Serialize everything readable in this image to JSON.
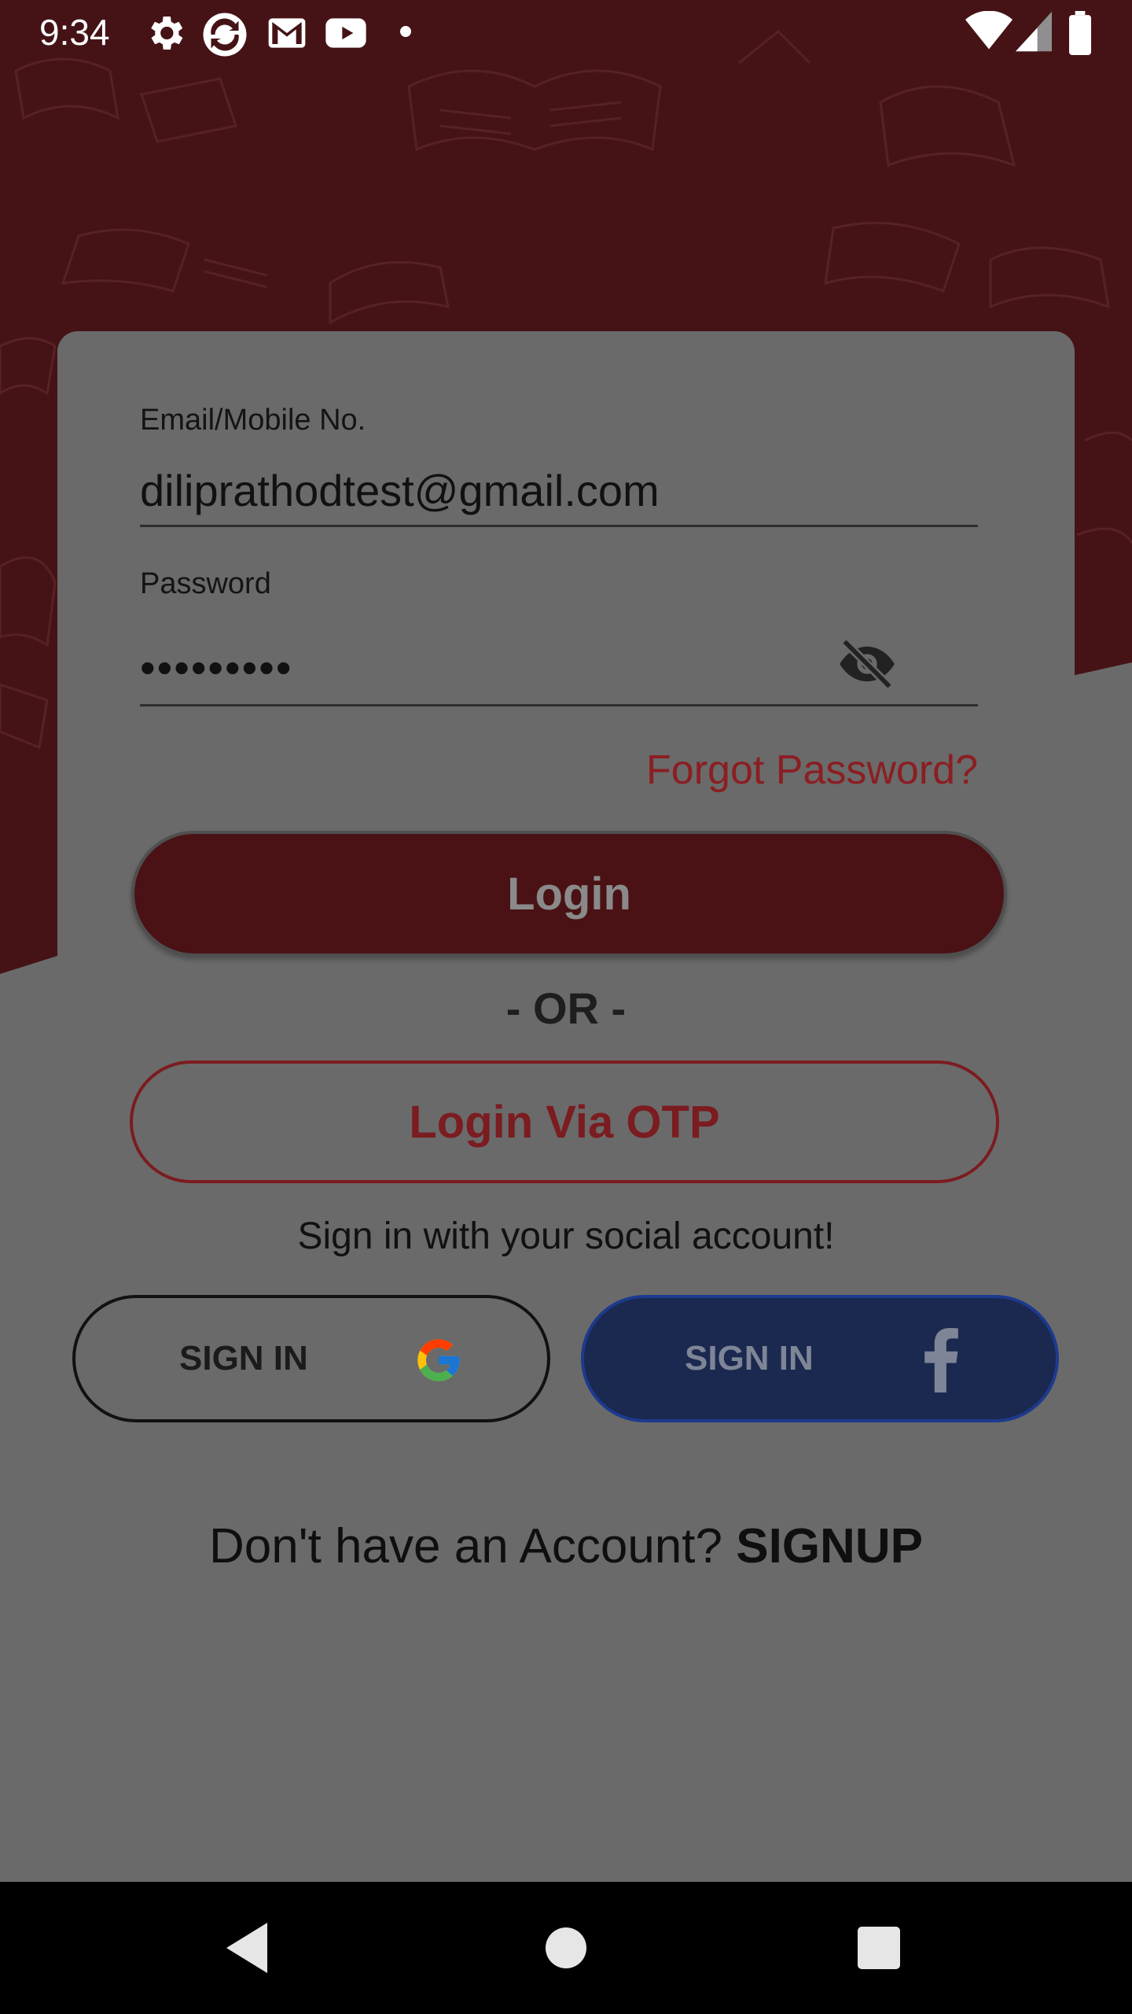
{
  "status_bar": {
    "time": "9:34",
    "icons_left": [
      "gear-icon",
      "sync-icon",
      "gmail-icon",
      "youtube-icon",
      "dot-icon"
    ],
    "icons_right": [
      "wifi-icon",
      "signal-icon",
      "battery-icon"
    ]
  },
  "form": {
    "email_label": "Email/Mobile No.",
    "email_value": "diliprathodtest@gmail.com",
    "password_label": "Password",
    "password_value": "•••••••••",
    "password_toggle_icon": "eye-off-icon",
    "forgot_password": "Forgot Password?",
    "login_button": "Login",
    "or_divider": "- OR -",
    "otp_button": "Login Via OTP"
  },
  "social": {
    "caption": "Sign in with your social account!",
    "google_label": "SIGN IN",
    "google_icon": "google-icon",
    "facebook_label": "SIGN IN",
    "facebook_icon": "facebook-icon"
  },
  "signup": {
    "prompt": "Don't have an Account? ",
    "link": "SIGNUP"
  },
  "nav_bar": {
    "buttons": [
      "back-icon",
      "home-icon",
      "recents-icon"
    ]
  },
  "colors": {
    "brand_red": "#4a1215",
    "accent_red": "#8b1e22",
    "facebook_blue": "#1b2950",
    "scrim_gray": "#6a6a6a"
  }
}
